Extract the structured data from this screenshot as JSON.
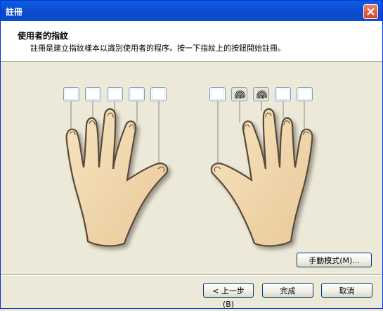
{
  "window": {
    "title": "註冊"
  },
  "header": {
    "heading": "使用者的指紋",
    "subtext": "註冊是建立指紋樣本以識別使用者的程序。按一下指紋上的按鈕開始註冊。"
  },
  "fingers": {
    "left_hand": [
      {
        "id": "left-pinky",
        "enrolled": false
      },
      {
        "id": "left-ring",
        "enrolled": false
      },
      {
        "id": "left-middle",
        "enrolled": false
      },
      {
        "id": "left-index",
        "enrolled": false
      },
      {
        "id": "left-thumb",
        "enrolled": false
      }
    ],
    "right_hand": [
      {
        "id": "right-thumb",
        "enrolled": false
      },
      {
        "id": "right-index",
        "enrolled": true
      },
      {
        "id": "right-middle",
        "enrolled": true
      },
      {
        "id": "right-ring",
        "enrolled": false
      },
      {
        "id": "right-pinky",
        "enrolled": false
      }
    ]
  },
  "buttons": {
    "manual_mode": "手動模式(M)...",
    "back": "< 上一步(B)",
    "finish": "完成",
    "cancel": "取消"
  },
  "colors": {
    "titlebar": "#0a5fe0",
    "dialog_bg": "#ece9d8",
    "hand_fill": "#f4dbb0",
    "hand_outline": "#5a4a3a"
  }
}
